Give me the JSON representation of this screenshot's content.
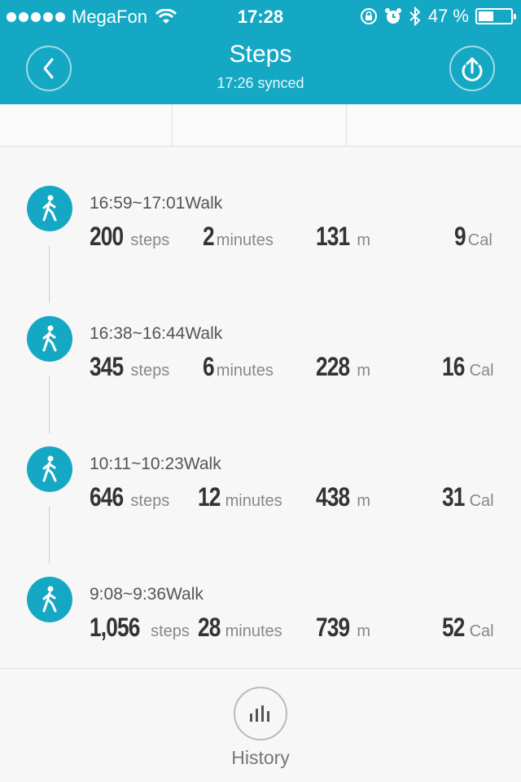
{
  "status_bar": {
    "carrier": "MegaFon",
    "time": "17:28",
    "battery_text": "47 %",
    "battery_level": 0.47,
    "signal_dots": 5
  },
  "nav": {
    "title": "Steps",
    "subtitle": "17:26 synced",
    "back_icon": "chevron-left-icon",
    "share_icon": "upload-icon"
  },
  "entries": [
    {
      "time": "16:59~17:01Walk",
      "steps": "200",
      "steps_unit": "steps",
      "minutes": "2",
      "minutes_unit": "minutes",
      "distance": "131",
      "distance_unit": "m",
      "calories": "9",
      "calories_unit": "Cal"
    },
    {
      "time": "16:38~16:44Walk",
      "steps": "345",
      "steps_unit": "steps",
      "minutes": "6",
      "minutes_unit": "minutes",
      "distance": "228",
      "distance_unit": "m",
      "calories": "16",
      "calories_unit": "Cal"
    },
    {
      "time": "10:11~10:23Walk",
      "steps": "646",
      "steps_unit": "steps",
      "minutes": "12",
      "minutes_unit": "minutes",
      "distance": "438",
      "distance_unit": "m",
      "calories": "31",
      "calories_unit": "Cal"
    },
    {
      "time": "9:08~9:36Walk",
      "steps": "1,056",
      "steps_unit": "steps",
      "minutes": "28",
      "minutes_unit": "minutes",
      "distance": "739",
      "distance_unit": "m",
      "calories": "52",
      "calories_unit": "Cal"
    }
  ],
  "footer": {
    "history_label": "History",
    "history_icon": "bar-chart-icon"
  },
  "colors": {
    "accent": "#14a8c4",
    "background": "#f7f7f7"
  }
}
